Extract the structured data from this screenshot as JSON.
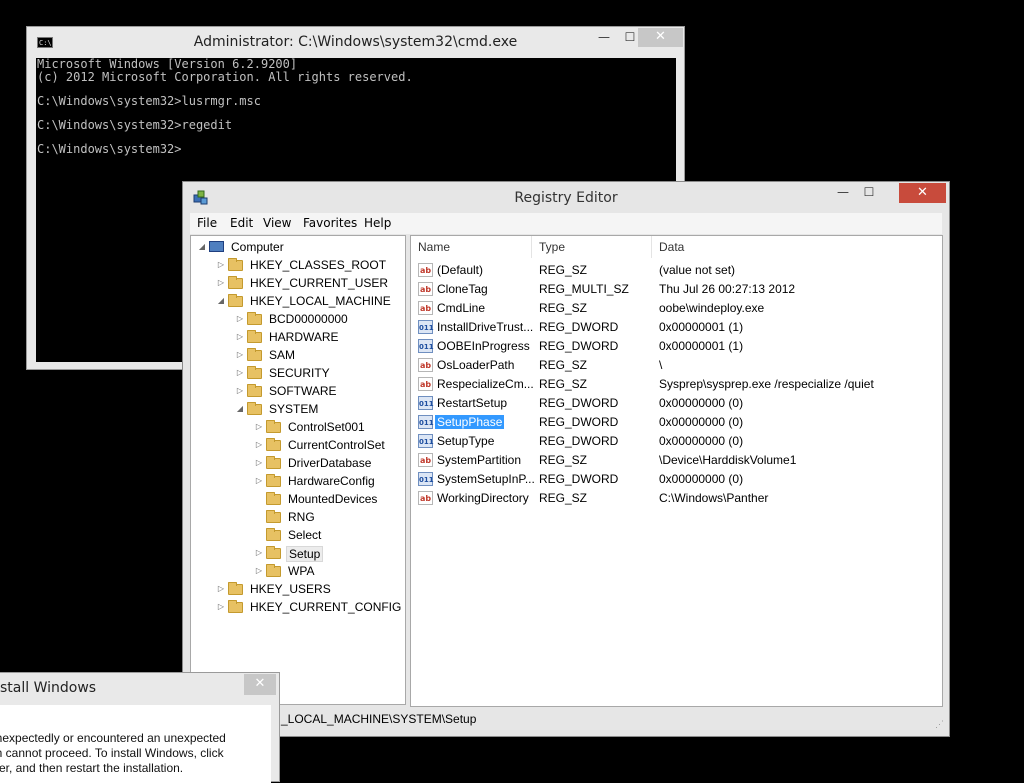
{
  "cmd": {
    "title": "Administrator: C:\\Windows\\system32\\cmd.exe",
    "icon_text": "C:\\",
    "min_glyph": "—",
    "max_glyph": "☐",
    "close_glyph": "✕",
    "lines": [
      "Microsoft Windows [Version 6.2.9200]",
      "(c) 2012 Microsoft Corporation. All rights reserved.",
      "C:\\Windows\\system32>lusrmgr.msc",
      "C:\\Windows\\system32>regedit",
      "C:\\Windows\\system32>"
    ]
  },
  "regedit": {
    "title": "Registry Editor",
    "min_glyph": "—",
    "max_glyph": "☐",
    "close_glyph": "✕",
    "menu": [
      "File",
      "Edit",
      "View",
      "Favorites",
      "Help"
    ],
    "tree": [
      {
        "label": "Computer",
        "expander": "◢",
        "icon": "computer"
      },
      {
        "label": "HKEY_CLASSES_ROOT",
        "expander": "▷",
        "icon": "folder"
      },
      {
        "label": "HKEY_CURRENT_USER",
        "expander": "▷",
        "icon": "folder"
      },
      {
        "label": "HKEY_LOCAL_MACHINE",
        "expander": "◢",
        "icon": "folder"
      },
      {
        "label": "BCD00000000",
        "expander": "▷",
        "icon": "folder"
      },
      {
        "label": "HARDWARE",
        "expander": "▷",
        "icon": "folder"
      },
      {
        "label": "SAM",
        "expander": "▷",
        "icon": "folder"
      },
      {
        "label": "SECURITY",
        "expander": "▷",
        "icon": "folder"
      },
      {
        "label": "SOFTWARE",
        "expander": "▷",
        "icon": "folder"
      },
      {
        "label": "SYSTEM",
        "expander": "◢",
        "icon": "folder"
      },
      {
        "label": "ControlSet001",
        "expander": "▷",
        "icon": "folder"
      },
      {
        "label": "CurrentControlSet",
        "expander": "▷",
        "icon": "folder"
      },
      {
        "label": "DriverDatabase",
        "expander": "▷",
        "icon": "folder"
      },
      {
        "label": "HardwareConfig",
        "expander": "▷",
        "icon": "folder"
      },
      {
        "label": "MountedDevices",
        "expander": "",
        "icon": "folder"
      },
      {
        "label": "RNG",
        "expander": "",
        "icon": "folder"
      },
      {
        "label": "Select",
        "expander": "",
        "icon": "folder"
      },
      {
        "label": "Setup",
        "expander": "▷",
        "icon": "folder",
        "selected": true
      },
      {
        "label": "WPA",
        "expander": "▷",
        "icon": "folder"
      },
      {
        "label": "HKEY_USERS",
        "expander": "▷",
        "icon": "folder"
      },
      {
        "label": "HKEY_CURRENT_CONFIG",
        "expander": "▷",
        "icon": "folder"
      }
    ],
    "columns": [
      "Name",
      "Type",
      "Data"
    ],
    "values": [
      {
        "icon": "string",
        "icon_text": "ab",
        "name": "(Default)",
        "type": "REG_SZ",
        "data": "(value not set)"
      },
      {
        "icon": "string",
        "icon_text": "ab",
        "name": "CloneTag",
        "type": "REG_MULTI_SZ",
        "data": "Thu Jul 26 00:27:13 2012"
      },
      {
        "icon": "string",
        "icon_text": "ab",
        "name": "CmdLine",
        "type": "REG_SZ",
        "data": "oobe\\windeploy.exe"
      },
      {
        "icon": "binary",
        "icon_text": "011",
        "name": "InstallDriveTrust...",
        "type": "REG_DWORD",
        "data": "0x00000001 (1)"
      },
      {
        "icon": "binary",
        "icon_text": "011",
        "name": "OOBEInProgress",
        "type": "REG_DWORD",
        "data": "0x00000001 (1)"
      },
      {
        "icon": "string",
        "icon_text": "ab",
        "name": "OsLoaderPath",
        "type": "REG_SZ",
        "data": "\\"
      },
      {
        "icon": "string",
        "icon_text": "ab",
        "name": "RespecializeCm...",
        "type": "REG_SZ",
        "data": "Sysprep\\sysprep.exe /respecialize /quiet"
      },
      {
        "icon": "binary",
        "icon_text": "011",
        "name": "RestartSetup",
        "type": "REG_DWORD",
        "data": "0x00000000 (0)"
      },
      {
        "icon": "binary",
        "icon_text": "011",
        "name": "SetupPhase",
        "type": "REG_DWORD",
        "data": "0x00000000 (0)",
        "selected": true
      },
      {
        "icon": "binary",
        "icon_text": "011",
        "name": "SetupType",
        "type": "REG_DWORD",
        "data": "0x00000000 (0)"
      },
      {
        "icon": "string",
        "icon_text": "ab",
        "name": "SystemPartition",
        "type": "REG_SZ",
        "data": "\\Device\\HarddiskVolume1"
      },
      {
        "icon": "binary",
        "icon_text": "011",
        "name": "SystemSetupInP...",
        "type": "REG_DWORD",
        "data": "0x00000000 (0)"
      },
      {
        "icon": "string",
        "icon_text": "ab",
        "name": "WorkingDirectory",
        "type": "REG_SZ",
        "data": "C:\\Windows\\Panther"
      }
    ],
    "status_path": "_LOCAL_MACHINE\\SYSTEM\\Setup",
    "grip_glyph": "⋰"
  },
  "install_dialog": {
    "title": "stall Windows",
    "close_glyph": "✕",
    "lines": [
      "unexpectedly or encountered an unexpected",
      "on cannot proceed. To install Windows, click",
      "uter, and then restart the installation."
    ]
  }
}
